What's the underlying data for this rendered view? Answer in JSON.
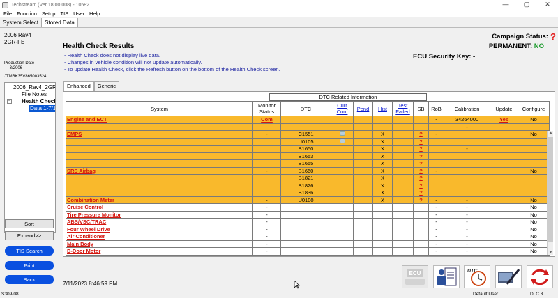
{
  "window": {
    "title": "Techstream (Ver 18.00.008) - 10582",
    "minimize": "—",
    "maximize": "▢",
    "close": "✕"
  },
  "menu": [
    "File",
    "Function",
    "Setup",
    "TIS",
    "User",
    "Help"
  ],
  "tabs": [
    "System Select",
    "Stored Data"
  ],
  "vehicle": {
    "model": "2006 Rav4",
    "engine": "2GR-FE",
    "production_label": "Production Date",
    "production_date": "- 3/2006",
    "vin": "JTMBK35V865003524"
  },
  "tree": {
    "root": "2006_Rav4_2GR",
    "file_notes": "File Notes",
    "health_check": "Health Check",
    "data": "Data 1-7/11"
  },
  "left_buttons": {
    "sort": "Sort",
    "expand": "Expand>>",
    "tis_search": "TIS Search",
    "print": "Print",
    "back": "Back"
  },
  "header": {
    "title": "Health Check Results",
    "campaign_status": "Campaign Status:",
    "help": "?",
    "permanent_label": "PERMANENT:",
    "permanent_value": "NO",
    "ecu_key": "ECU Security Key: -"
  },
  "notes": [
    "- Health Check does not display live data.",
    "- Changes in vehicle condition will not update automatically.",
    "- To update Health Check, click the Refresh button on the bottom of the Health Check screen."
  ],
  "subtabs": [
    "Enhanced",
    "Generic"
  ],
  "grid": {
    "group_header": "DTC Related Information",
    "columns": [
      "System",
      "Monitor Status",
      "DTC",
      "Curr Conf",
      "Pend",
      "Hist",
      "Test Failed",
      "SB",
      "RoB",
      "Calibration",
      "Update",
      "Configure"
    ],
    "rows": [
      {
        "system": "Engine and ECT",
        "monitor": "Com",
        "dtc": "",
        "hist": "",
        "sb": "",
        "rob": "-",
        "calibration": "34264000",
        "update": "Yes",
        "configure": "No",
        "style": "o"
      },
      {
        "system": "",
        "monitor": "",
        "dtc": "",
        "hist": "",
        "sb": "",
        "rob": "",
        "calibration": "-",
        "update": "",
        "configure": "",
        "style": "o"
      },
      {
        "system": "EMPS",
        "monitor": "-",
        "dtc": "C1551",
        "hist": "X",
        "sb": "?",
        "rob": "-",
        "calibration": "",
        "update": "",
        "configure": "No",
        "style": "o",
        "icon": true
      },
      {
        "system": "",
        "monitor": "",
        "dtc": "U0105",
        "hist": "X",
        "sb": "?",
        "rob": "",
        "calibration": "",
        "update": "",
        "configure": "",
        "style": "o",
        "icon": true
      },
      {
        "system": "",
        "monitor": "",
        "dtc": "B1650",
        "hist": "X",
        "sb": "?",
        "rob": "",
        "calibration": "-",
        "update": "",
        "configure": "",
        "style": "o"
      },
      {
        "system": "",
        "monitor": "",
        "dtc": "B1653",
        "hist": "X",
        "sb": "?",
        "rob": "",
        "calibration": "",
        "update": "",
        "configure": "",
        "style": "o"
      },
      {
        "system": "",
        "monitor": "",
        "dtc": "B1655",
        "hist": "X",
        "sb": "?",
        "rob": "",
        "calibration": "",
        "update": "",
        "configure": "",
        "style": "o"
      },
      {
        "system": "SRS Airbag",
        "monitor": "-",
        "dtc": "B1660",
        "hist": "X",
        "sb": "?",
        "rob": "-",
        "calibration": "",
        "update": "",
        "configure": "No",
        "style": "o"
      },
      {
        "system": "",
        "monitor": "",
        "dtc": "B1821",
        "hist": "X",
        "sb": "?",
        "rob": "",
        "calibration": "",
        "update": "",
        "configure": "",
        "style": "o"
      },
      {
        "system": "",
        "monitor": "",
        "dtc": "B1826",
        "hist": "X",
        "sb": "?",
        "rob": "",
        "calibration": "",
        "update": "",
        "configure": "",
        "style": "o"
      },
      {
        "system": "",
        "monitor": "",
        "dtc": "B1836",
        "hist": "X",
        "sb": "?",
        "rob": "",
        "calibration": "",
        "update": "",
        "configure": "",
        "style": "o"
      },
      {
        "system": "Combination Meter",
        "monitor": "-",
        "dtc": "U0100",
        "hist": "X",
        "sb": "?",
        "rob": "-",
        "calibration": "-",
        "update": "",
        "configure": "No",
        "style": "o"
      },
      {
        "system": "Cruise Control",
        "monitor": "-",
        "dtc": "",
        "hist": "",
        "sb": "",
        "rob": "-",
        "calibration": "-",
        "update": "",
        "configure": "No",
        "style": "w"
      },
      {
        "system": "Tire Pressure Monitor",
        "monitor": "-",
        "dtc": "",
        "hist": "",
        "sb": "",
        "rob": "-",
        "calibration": "-",
        "update": "",
        "configure": "No",
        "style": "w"
      },
      {
        "system": "ABS/VSC/TRAC",
        "monitor": "-",
        "dtc": "",
        "hist": "",
        "sb": "",
        "rob": "-",
        "calibration": "-",
        "update": "",
        "configure": "No",
        "style": "w"
      },
      {
        "system": "Four Wheel Drive",
        "monitor": "-",
        "dtc": "",
        "hist": "",
        "sb": "",
        "rob": "-",
        "calibration": "-",
        "update": "",
        "configure": "No",
        "style": "w"
      },
      {
        "system": "Air Conditioner",
        "monitor": "-",
        "dtc": "",
        "hist": "",
        "sb": "",
        "rob": "-",
        "calibration": "-",
        "update": "",
        "configure": "No",
        "style": "w"
      },
      {
        "system": "Main Body",
        "monitor": "-",
        "dtc": "",
        "hist": "",
        "sb": "",
        "rob": "-",
        "calibration": "-",
        "update": "",
        "configure": "No",
        "style": "w"
      },
      {
        "system": "D-Door Motor",
        "monitor": "-",
        "dtc": "",
        "hist": "",
        "sb": "",
        "rob": "-",
        "calibration": "-",
        "update": "",
        "configure": "No",
        "style": "w"
      }
    ]
  },
  "footer": {
    "timestamp": "7/11/2023 8:46:59 PM",
    "ecu_button": "ECU",
    "dtc_button": "DTC"
  },
  "statusbar": {
    "code": "S309-08",
    "user": "Default User",
    "dlc": "DLC 3"
  },
  "colors": {
    "orange_row": "#f9b92c",
    "link_red": "#d4160e",
    "blue_button": "#0a50e0",
    "note_blue": "#1e25a2",
    "green_no": "#1a9a2b"
  }
}
